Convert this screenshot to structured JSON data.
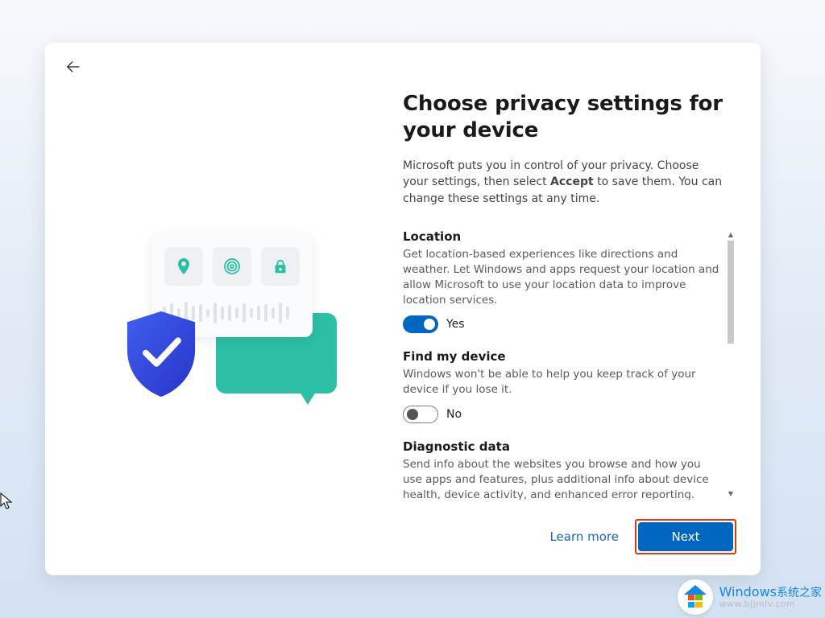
{
  "header": {
    "title": "Choose privacy settings for your device",
    "intro_pre": "Microsoft puts you in control of your privacy. Choose your settings, then select ",
    "intro_bold": "Accept",
    "intro_post": " to save them. You can change these settings at any time."
  },
  "settings": {
    "location": {
      "title": "Location",
      "desc": "Get location-based experiences like directions and weather. Let Windows and apps request your location and allow Microsoft to use your location data to improve location services.",
      "state_label": "Yes",
      "on": true
    },
    "find_my_device": {
      "title": "Find my device",
      "desc": "Windows won't be able to help you keep track of your device if you lose it.",
      "state_label": "No",
      "on": false
    },
    "diagnostic": {
      "title": "Diagnostic data",
      "desc": "Send info about the websites you browse and how you use apps and features, plus additional info about device health, device activity, and enhanced error reporting. Required diagnostic data will always be included when"
    }
  },
  "footer": {
    "learn_more": "Learn more",
    "next": "Next"
  },
  "watermark": {
    "line1_en": "Windows",
    "line1_cn": "系统之家",
    "line2": "www.bjjmlv.com"
  }
}
